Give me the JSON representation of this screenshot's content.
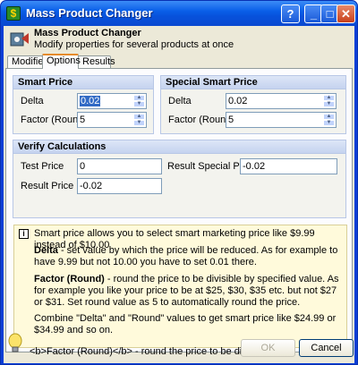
{
  "window": {
    "title": "Mass Product Changer"
  },
  "header": {
    "title": "Mass Product Changer",
    "subtitle": "Modify properties for several products at once"
  },
  "tabs": [
    {
      "label": "Modifier"
    },
    {
      "label": "Options"
    },
    {
      "label": "Results"
    }
  ],
  "smart_price": {
    "title": "Smart Price",
    "delta_label": "Delta",
    "delta_value": "0.02",
    "factor_label": "Factor (Round)",
    "factor_value": "5"
  },
  "special_smart_price": {
    "title": "Special Smart Price",
    "delta_label": "Delta",
    "delta_value": "0.02",
    "factor_label": "Factor (Round)",
    "factor_value": "5"
  },
  "verify": {
    "title": "Verify Calculations",
    "test_price_label": "Test Price",
    "test_price_value": "0",
    "result_special_label": "Result Special Price",
    "result_special_value": "-0.02",
    "result_price_label": "Result Price",
    "result_price_value": "-0.02"
  },
  "info": {
    "intro": "Smart price allows you to select smart marketing price like $9.99 instead of $10.00",
    "delta_title": "Delta",
    "delta_text": " - set value by which the price will be reduced. As for example to have 9.99 but not 10.00 you have to set 0.01 there.",
    "factor_title": "Factor (Round)",
    "factor_text": " - round the price to be divisible by specified value. As for example you like your price to be at $25, $30, $35 etc. but not $27 or $31. Set round value as 5 to automatically round the price.",
    "combine": "Combine \"Delta\" and \"Round\" values to get smart price like $24.99 or $34.99 and so on."
  },
  "footer": {
    "hint": "<b>Factor (Round)</b> - round the price to be divisible by",
    "ok_label": "OK",
    "cancel_label": "Cancel"
  },
  "colors": {
    "accent": "#0a5fe8",
    "tab_highlight": "#e68b2c",
    "group_header": "#c5d3ef"
  }
}
